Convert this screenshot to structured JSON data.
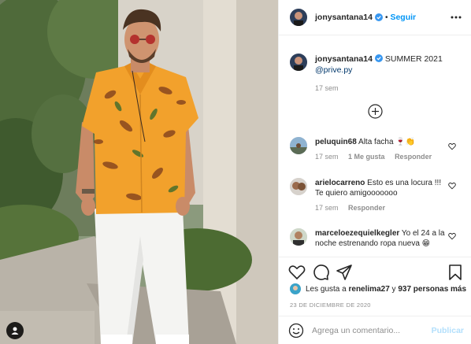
{
  "post": {
    "username": "jonysantana14",
    "follow_label": "Seguir",
    "separator": "•"
  },
  "caption": {
    "username": "jonysantana14",
    "text": "SUMMER 2021",
    "mention": "@prive.py",
    "time": "17 sem"
  },
  "comments": [
    {
      "username": "peluquin68",
      "text": "Alta facha 🍷👏",
      "time": "17 sem",
      "likes": "1 Me gusta",
      "reply": "Responder"
    },
    {
      "username": "arielocarreno",
      "text": "Esto es una locura !!! Te quiero amigooooooo",
      "time": "17 sem",
      "reply": "Responder"
    },
    {
      "username": "marceloezequielkegler",
      "text": "Yo el 24 a la noche estrenando ropa nueva 😁"
    }
  ],
  "likes": {
    "prefix": "Les gusta a",
    "user": "renelima27",
    "middle": "y",
    "count": "937 personas más"
  },
  "date": "23 DE DICIEMBRE DE 2020",
  "add_comment": {
    "placeholder": "Agrega un comentario...",
    "publish": "Publicar"
  },
  "colors": {
    "link": "#0095f6",
    "shirt": "#f2a12c",
    "publish_disabled": "#b2dffc"
  },
  "icons": [
    "verified-badge-icon",
    "more-options-icon",
    "load-more-comments-icon",
    "heart-icon",
    "comment-icon",
    "share-icon",
    "save-icon",
    "emoji-icon",
    "user-tag-icon"
  ]
}
